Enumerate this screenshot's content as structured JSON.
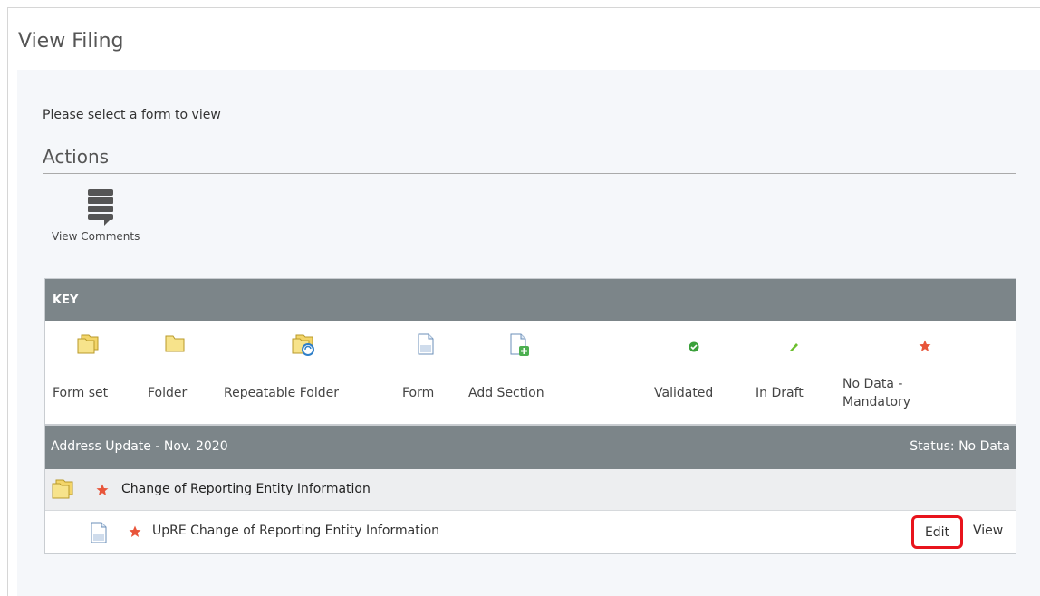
{
  "page": {
    "title": "View Filing"
  },
  "instruction": "Please select a form to view",
  "actions": {
    "heading": "Actions",
    "view_comments_label": "View Comments"
  },
  "key": {
    "header": "KEY",
    "items": [
      {
        "icon": "form-set-icon",
        "label": "Form set"
      },
      {
        "icon": "folder-icon",
        "label": "Folder"
      },
      {
        "icon": "repeatable-folder-icon",
        "label": "Repeatable Folder"
      },
      {
        "icon": "form-icon",
        "label": "Form"
      },
      {
        "icon": "add-section-icon",
        "label": "Add Section"
      },
      {
        "icon": "validated-icon",
        "label": "Validated"
      },
      {
        "icon": "in-draft-icon",
        "label": "In Draft"
      },
      {
        "icon": "no-data-mandatory-icon",
        "label_line1": "No Data -",
        "label_line2": "Mandatory"
      }
    ]
  },
  "filing": {
    "title": "Address Update - Nov. 2020",
    "status": "Status: No Data",
    "folder": {
      "label": "Change of Reporting Entity Information"
    },
    "form": {
      "label": "UpRE Change of Reporting Entity Information",
      "edit_label": "Edit",
      "view_label": "View"
    }
  },
  "colors": {
    "header_bar": "#7c8589",
    "panel_bg": "#f5f7fa",
    "highlight": "#e8141c",
    "star": "#e8553a",
    "validated": "#3aa03a"
  }
}
